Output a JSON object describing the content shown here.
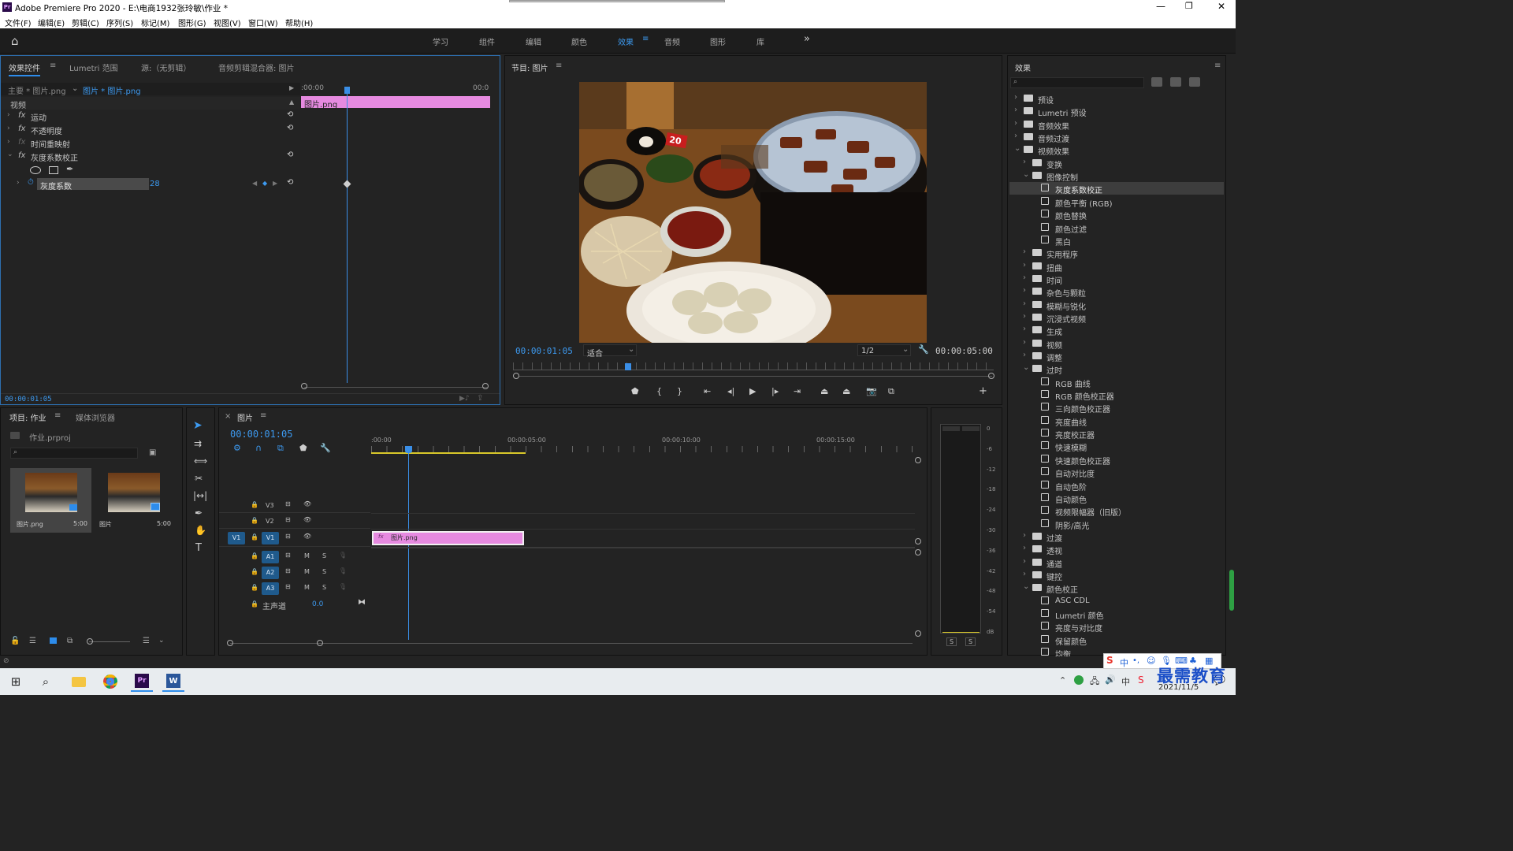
{
  "window": {
    "app_icon": "Pr",
    "title": "Adobe Premiere Pro 2020 - E:\\电商1932张玲敏\\作业 *"
  },
  "menu": [
    "文件(F)",
    "编辑(E)",
    "剪辑(C)",
    "序列(S)",
    "标记(M)",
    "图形(G)",
    "视图(V)",
    "窗口(W)",
    "帮助(H)"
  ],
  "workspaces": {
    "tabs": [
      "学习",
      "组件",
      "编辑",
      "颜色",
      "效果",
      "音频",
      "图形",
      "库"
    ],
    "active": "效果",
    "more": "»"
  },
  "effect_controls": {
    "tabs": [
      "效果控件",
      "Lumetri 范围",
      "源:（无剪辑）",
      "音频剪辑混合器: 图片"
    ],
    "master": "主要 * 图片.png",
    "clip": "图片 * 图片.png",
    "tc_start": ":00:00",
    "tc_end": "00:0",
    "clip_bar_label": "图片.png",
    "section": "视频",
    "items": [
      "运动",
      "不透明度",
      "时间重映射",
      "灰度系数校正"
    ],
    "param_label": "灰度系数",
    "param_value": "28",
    "timecode": "00:00:01:05"
  },
  "program": {
    "title": "节目: 图片",
    "timecode": "00:00:01:05",
    "fit": "适合",
    "resolution": "1/2",
    "duration": "00:00:05:00",
    "badge": "20"
  },
  "effects_panel": {
    "title": "效果",
    "search_placeholder": "",
    "tree": [
      {
        "label": "预设",
        "level": 0,
        "open": false,
        "kind": "special"
      },
      {
        "label": "Lumetri 预设",
        "level": 0,
        "open": false,
        "kind": "special"
      },
      {
        "label": "音频效果",
        "level": 0,
        "open": false,
        "kind": "folder"
      },
      {
        "label": "音频过渡",
        "level": 0,
        "open": false,
        "kind": "folder"
      },
      {
        "label": "视频效果",
        "level": 0,
        "open": true,
        "kind": "folder"
      },
      {
        "label": "变换",
        "level": 1,
        "open": false,
        "kind": "folder"
      },
      {
        "label": "图像控制",
        "level": 1,
        "open": true,
        "kind": "folder"
      },
      {
        "label": "灰度系数校正",
        "level": 2,
        "kind": "fx",
        "selected": true
      },
      {
        "label": "颜色平衡 (RGB)",
        "level": 2,
        "kind": "fx"
      },
      {
        "label": "颜色替换",
        "level": 2,
        "kind": "fx"
      },
      {
        "label": "颜色过滤",
        "level": 2,
        "kind": "fx"
      },
      {
        "label": "黑白",
        "level": 2,
        "kind": "fx"
      },
      {
        "label": "实用程序",
        "level": 1,
        "open": false,
        "kind": "folder"
      },
      {
        "label": "扭曲",
        "level": 1,
        "open": false,
        "kind": "folder"
      },
      {
        "label": "时间",
        "level": 1,
        "open": false,
        "kind": "folder"
      },
      {
        "label": "杂色与颗粒",
        "level": 1,
        "open": false,
        "kind": "folder"
      },
      {
        "label": "模糊与锐化",
        "level": 1,
        "open": false,
        "kind": "folder"
      },
      {
        "label": "沉浸式视频",
        "level": 1,
        "open": false,
        "kind": "folder"
      },
      {
        "label": "生成",
        "level": 1,
        "open": false,
        "kind": "folder"
      },
      {
        "label": "视频",
        "level": 1,
        "open": false,
        "kind": "folder"
      },
      {
        "label": "调整",
        "level": 1,
        "open": false,
        "kind": "folder"
      },
      {
        "label": "过时",
        "level": 1,
        "open": true,
        "kind": "folder"
      },
      {
        "label": "RGB 曲线",
        "level": 2,
        "kind": "fx"
      },
      {
        "label": "RGB 颜色校正器",
        "level": 2,
        "kind": "fx"
      },
      {
        "label": "三向颜色校正器",
        "level": 2,
        "kind": "fx"
      },
      {
        "label": "亮度曲线",
        "level": 2,
        "kind": "fx"
      },
      {
        "label": "亮度校正器",
        "level": 2,
        "kind": "fx"
      },
      {
        "label": "快速模糊",
        "level": 2,
        "kind": "fx"
      },
      {
        "label": "快速颜色校正器",
        "level": 2,
        "kind": "fx"
      },
      {
        "label": "自动对比度",
        "level": 2,
        "kind": "fx"
      },
      {
        "label": "自动色阶",
        "level": 2,
        "kind": "fx"
      },
      {
        "label": "自动颜色",
        "level": 2,
        "kind": "fx"
      },
      {
        "label": "视频限幅器（旧版）",
        "level": 2,
        "kind": "fx"
      },
      {
        "label": "阴影/高光",
        "level": 2,
        "kind": "fx"
      },
      {
        "label": "过渡",
        "level": 1,
        "open": false,
        "kind": "folder"
      },
      {
        "label": "透视",
        "level": 1,
        "open": false,
        "kind": "folder"
      },
      {
        "label": "通道",
        "level": 1,
        "open": false,
        "kind": "folder"
      },
      {
        "label": "键控",
        "level": 1,
        "open": false,
        "kind": "folder"
      },
      {
        "label": "颜色校正",
        "level": 1,
        "open": true,
        "kind": "folder"
      },
      {
        "label": "ASC CDL",
        "level": 2,
        "kind": "fx"
      },
      {
        "label": "Lumetri 颜色",
        "level": 2,
        "kind": "fx"
      },
      {
        "label": "亮度与对比度",
        "level": 2,
        "kind": "fx"
      },
      {
        "label": "保留颜色",
        "level": 2,
        "kind": "fx"
      },
      {
        "label": "均衡",
        "level": 2,
        "kind": "fx"
      }
    ]
  },
  "project": {
    "tabs": [
      "项目: 作业",
      "媒体浏览器"
    ],
    "file": "作业.prproj",
    "items": [
      {
        "name": "图片.png",
        "duration": "5:00"
      },
      {
        "name": "图片",
        "duration": "5:00"
      }
    ]
  },
  "timeline": {
    "title": "图片",
    "timecode": "00:00:01:05",
    "ruler": [
      ":00:00",
      "00:00:05:00",
      "00:00:10:00",
      "00:00:15:00"
    ],
    "video_tracks": [
      "V3",
      "V2",
      "V1"
    ],
    "audio_tracks": [
      "A1",
      "A2",
      "A3"
    ],
    "source_patch": "V1",
    "master_label": "主声道",
    "master_value": "0.0",
    "clip_label": "图片.png",
    "mute": "M",
    "solo": "S"
  },
  "meter": {
    "scale": [
      "0",
      "-6",
      "-12",
      "-18",
      "-24",
      "-30",
      "-36",
      "-42",
      "-48",
      "-54",
      "dB"
    ],
    "buttons": [
      "S",
      "S"
    ]
  },
  "taskbar": {
    "date": "2021/11/5",
    "watermark": "最需教育",
    "ime": "中"
  },
  "colors": {
    "accent": "#2d8ceb",
    "clip": "#e68ae0",
    "playhead": "#3a8ee6"
  }
}
